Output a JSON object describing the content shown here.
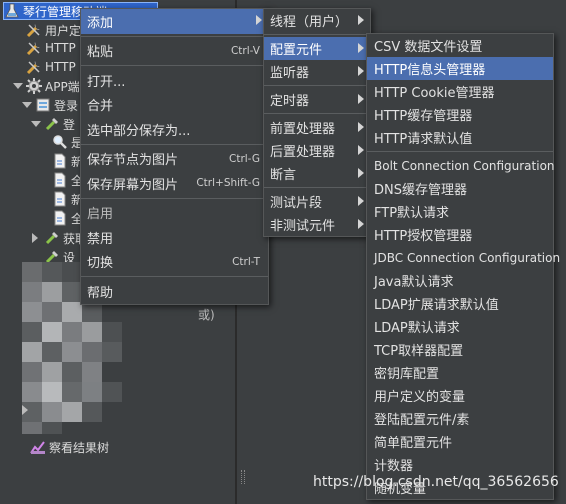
{
  "tree": {
    "root_label": "琴行管理移动端",
    "nodes": [
      {
        "label": "用户定"
      },
      {
        "label": "HTTP"
      },
      {
        "label": "HTTP"
      },
      {
        "label": "APP端"
      },
      {
        "label": "登录"
      },
      {
        "label": "登"
      },
      {
        "label": "是"
      },
      {
        "label": "新"
      },
      {
        "label": "全"
      },
      {
        "label": "新"
      },
      {
        "label": "全"
      },
      {
        "label": "获取"
      },
      {
        "label": "设"
      },
      {
        "label": "察看结果树"
      }
    ],
    "blurred_text": "或)"
  },
  "menu_main": {
    "items": [
      {
        "label": "添加",
        "shortcut": "",
        "submenu": true,
        "selected": true
      },
      {
        "label": "粘贴",
        "shortcut": "Ctrl-V"
      },
      {
        "label": "打开..."
      },
      {
        "label": "合并"
      },
      {
        "label": "选中部分保存为..."
      },
      {
        "label": "保存节点为图片",
        "shortcut": "Ctrl-G"
      },
      {
        "label": "保存屏幕为图片",
        "shortcut": "Ctrl+Shift-G"
      },
      {
        "label": "启用"
      },
      {
        "label": "禁用"
      },
      {
        "label": "切换",
        "shortcut": "Ctrl-T"
      },
      {
        "label": "帮助"
      }
    ]
  },
  "menu_add": {
    "items": [
      {
        "label": "线程（用户）"
      },
      {
        "label": "配置元件",
        "selected": true
      },
      {
        "label": "监听器"
      },
      {
        "label": "定时器"
      },
      {
        "label": "前置处理器"
      },
      {
        "label": "后置处理器"
      },
      {
        "label": "断言"
      },
      {
        "label": "测试片段"
      },
      {
        "label": "非测试元件"
      }
    ]
  },
  "menu_config": {
    "items": [
      {
        "label": "CSV 数据文件设置"
      },
      {
        "label": "HTTP信息头管理器",
        "selected": true
      },
      {
        "label": "HTTP Cookie管理器"
      },
      {
        "label": "HTTP缓存管理器"
      },
      {
        "label": "HTTP请求默认值"
      },
      {
        "label": "Bolt Connection Configuration"
      },
      {
        "label": "DNS缓存管理器"
      },
      {
        "label": "FTP默认请求"
      },
      {
        "label": "HTTP授权管理器"
      },
      {
        "label": "JDBC Connection Configuration"
      },
      {
        "label": "Java默认请求"
      },
      {
        "label": "LDAP扩展请求默认值"
      },
      {
        "label": "LDAP默认请求"
      },
      {
        "label": "TCP取样器配置"
      },
      {
        "label": "密钥库配置"
      },
      {
        "label": "用户定义的变量"
      },
      {
        "label": "登陆配置元件/素"
      },
      {
        "label": "简单配置元件"
      },
      {
        "label": "计数器"
      },
      {
        "label": "随机变量"
      }
    ]
  },
  "watermark": "https://blog.csdn.net/qq_36562656",
  "colors": {
    "background": "#3c3f41",
    "selection": "#4b6eaf",
    "tree_selection": "#2f65ca",
    "text": "#e2e2e2"
  }
}
